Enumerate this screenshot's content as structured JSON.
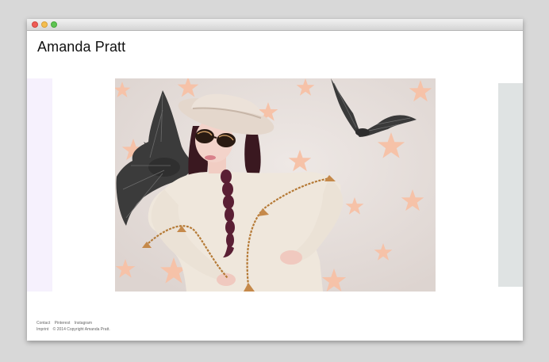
{
  "site": {
    "title": "Amanda Pratt"
  },
  "gallery": {
    "current_image": "photo of woman in white hat, bat-decorated sunglasses and cream sweater with stars and bats"
  },
  "footer": {
    "links": [
      "Contact",
      "Pinterest",
      "Instagram"
    ],
    "imprint": "Imprint",
    "copyright": "© 2014 Copyright Amanda Pratt."
  },
  "colors": {
    "page_background": "#d8d8d8",
    "window_background": "#ffffff",
    "left_slide_tint": "#f6f1fd",
    "right_slide_tint": "#dfe3e3",
    "star_color": "#f6c2a8"
  }
}
